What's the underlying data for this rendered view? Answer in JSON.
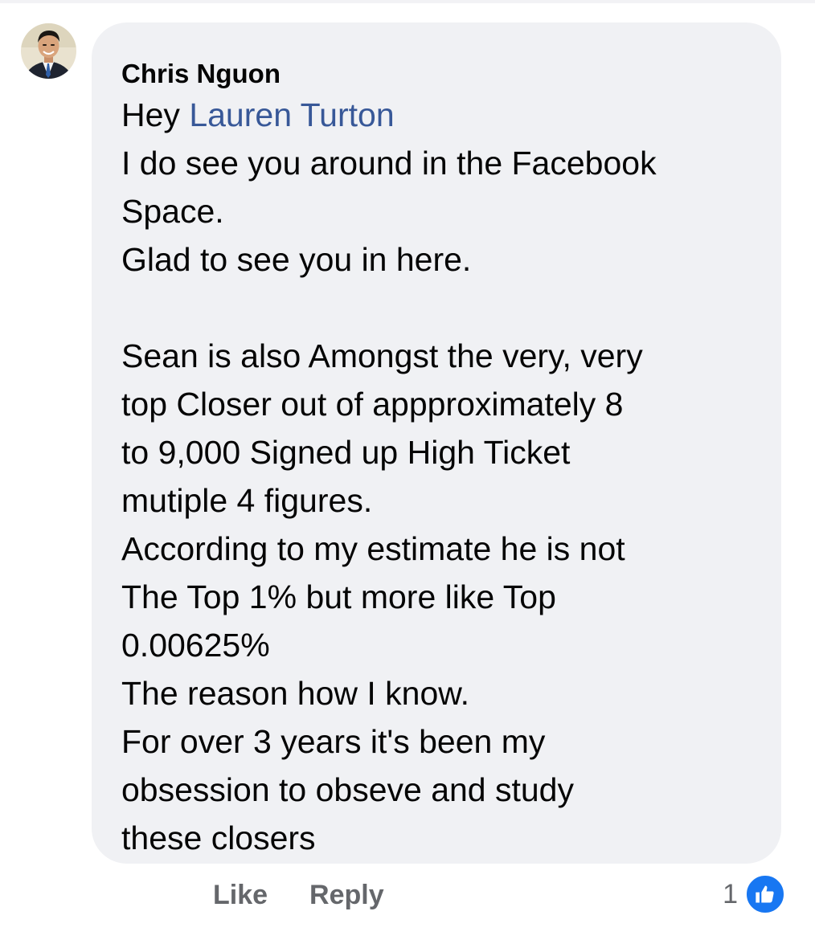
{
  "comment": {
    "author": "Chris Nguon",
    "greeting": "Hey",
    "mention": "Lauren Turton",
    "lines": [
      "I do see you around in the Facebook",
      "Space.",
      "Glad to see you in here.",
      "",
      "Sean is also Amongst the very, very",
      "top Closer out of appproximately 8",
      "to 9,000 Signed up High Ticket",
      "mutiple 4 figures.",
      "According to my estimate he is not",
      "The Top 1% but more like Top",
      "0.00625%",
      "The reason how I know.",
      "For over 3 years it's been my",
      "obsession to obseve and study",
      "these closers"
    ]
  },
  "actions": {
    "like_label": "Like",
    "reply_label": "Reply"
  },
  "reactions": {
    "count": "1",
    "icon": "thumbs-up-icon",
    "color": "#1877f2"
  },
  "colors": {
    "bubble": "#f0f1f4",
    "mention": "#385898",
    "text": "#050505",
    "muted": "#65676b"
  }
}
